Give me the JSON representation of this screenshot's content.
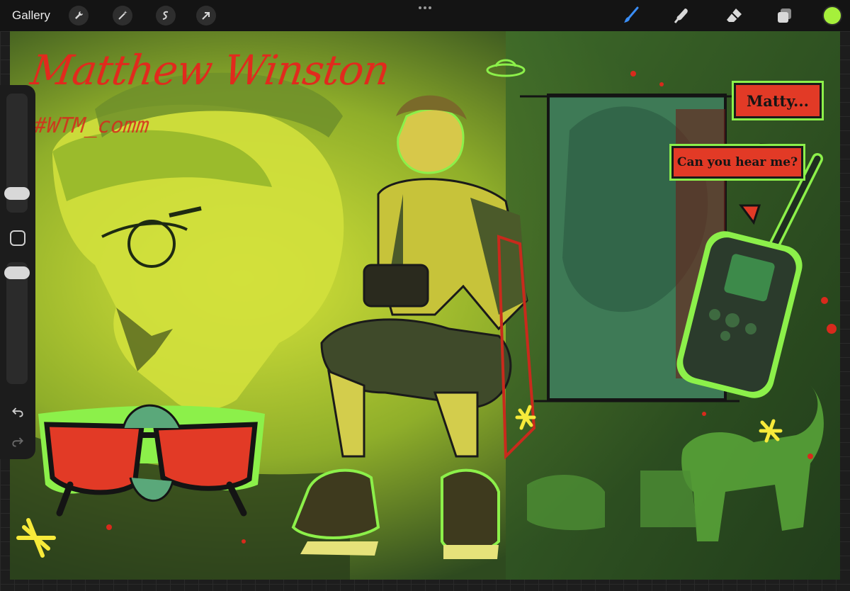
{
  "app": {
    "gallery_label": "Gallery",
    "tools_left": [
      "wrench-icon",
      "magic-wand-icon",
      "selection-icon",
      "transform-arrow-icon"
    ],
    "tools_right": [
      "brush-icon",
      "smudge-icon",
      "eraser-icon",
      "layers-icon"
    ],
    "active_color": "#a6f03b",
    "active_tool": "brush"
  },
  "artwork": {
    "title": "Matthew Winston",
    "hashtag": "#WTM_comm",
    "bubble_1": "Matty...",
    "bubble_2": "Can you hear me?"
  },
  "palette": {
    "accent_green": "#8cf04a",
    "red": "#e12a1d",
    "lime_bg": "#c9d93a",
    "dark_green": "#2f5a2a"
  }
}
